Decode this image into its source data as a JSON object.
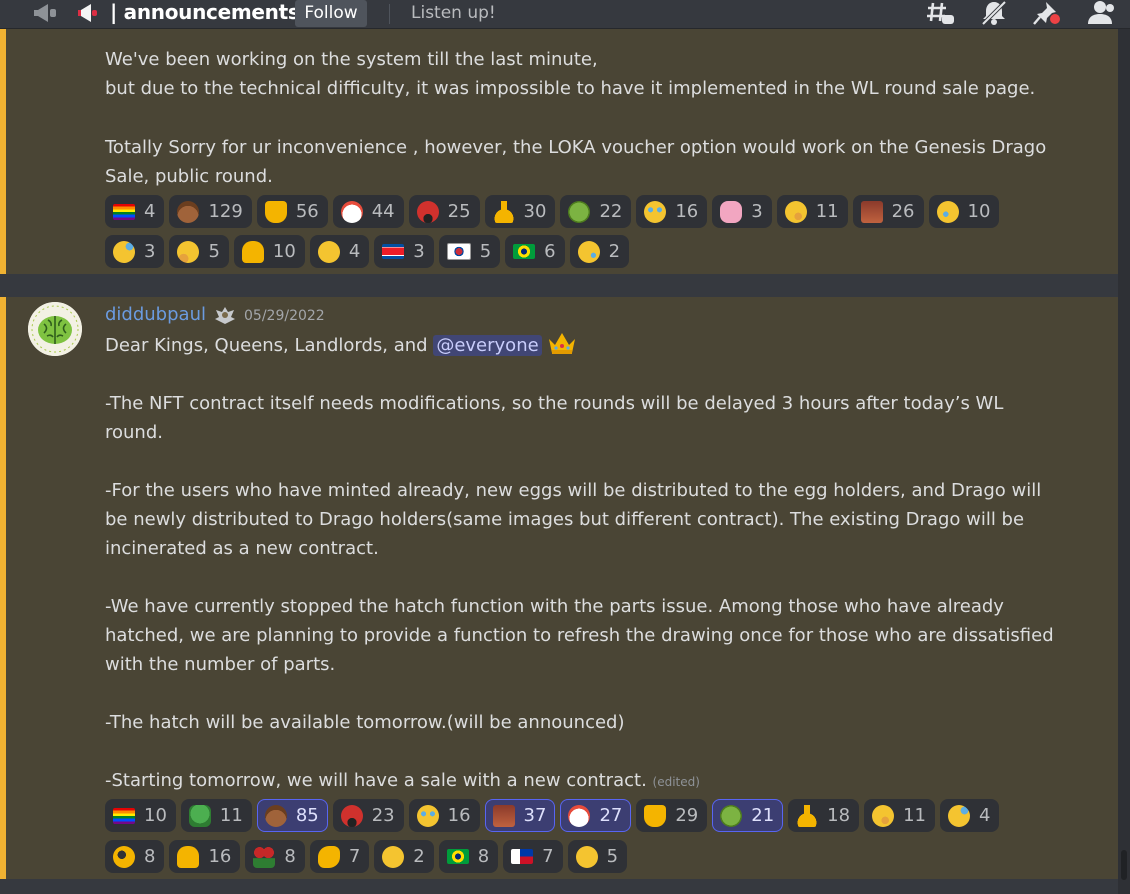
{
  "header": {
    "channel_name": "| announcements",
    "follow_label": "Follow",
    "topic": "Listen up!",
    "icons": [
      "threads-icon",
      "mute-bell-icon",
      "pin-icon",
      "members-icon"
    ]
  },
  "messages": [
    {
      "paragraphs": [
        "We've been working on the system till the last minute,\nbut due to the technical difficulty, it was impossible to have it implemented in the WL round sale page.",
        "Totally Sorry for ur inconvenience , however, the LOKA voucher option would work on the Genesis Drago Sale, public round."
      ],
      "reactions_row1": [
        {
          "emoji": "rainbow-flag",
          "count": "4"
        },
        {
          "emoji": "poop",
          "count": "129"
        },
        {
          "emoji": "thumbs-down",
          "count": "56"
        },
        {
          "emoji": "clown",
          "count": "44"
        },
        {
          "emoji": "angry-swearing",
          "count": "25"
        },
        {
          "emoji": "middle-finger",
          "count": "30"
        },
        {
          "emoji": "nauseated",
          "count": "22"
        },
        {
          "emoji": "joy",
          "count": "16"
        },
        {
          "emoji": "ghost-face",
          "count": "3"
        },
        {
          "emoji": "shushing",
          "count": "11"
        },
        {
          "emoji": "custom-face",
          "count": "26"
        },
        {
          "emoji": "rofl",
          "count": "10"
        }
      ],
      "reactions_row2": [
        {
          "emoji": "sad-sweat",
          "count": "3"
        },
        {
          "emoji": "thinking",
          "count": "5"
        },
        {
          "emoji": "thumbs-up",
          "count": "10"
        },
        {
          "emoji": "upside-down",
          "count": "4"
        },
        {
          "emoji": "flag-north-korea",
          "count": "3"
        },
        {
          "emoji": "flag-south-korea",
          "count": "5"
        },
        {
          "emoji": "flag-brazil",
          "count": "6"
        },
        {
          "emoji": "smiling-tear",
          "count": "2"
        }
      ]
    },
    {
      "author": "diddubpaul",
      "timestamp": "05/29/2022",
      "greeting_prefix": "Dear Kings, Queens, Landlords, and ",
      "mention": "@everyone",
      "paragraphs": [
        "-The NFT contract itself needs modifications, so the rounds will be delayed 3 hours after today’s WL round.",
        "-For the users who have minted already, new eggs will be distributed to the egg holders, and Drago will be newly distributed to Drago holders(same images but different contract). The existing Drago will be incinerated as a new contract.",
        "-We have currently stopped the hatch function with the parts issue. Among those who have already hatched, we are planning to provide a function to refresh the drawing once for those who are dissatisfied with the number of parts.",
        "-The hatch will be available tomorrow.(will be announced)",
        "-Starting tomorrow, we will have a sale with a new contract."
      ],
      "edited_label": "(edited)",
      "reactions_row1": [
        {
          "emoji": "rainbow-flag",
          "count": "10",
          "me": false
        },
        {
          "emoji": "pepe",
          "count": "11",
          "me": false
        },
        {
          "emoji": "poop",
          "count": "85",
          "me": true
        },
        {
          "emoji": "angry-swearing",
          "count": "23",
          "me": false
        },
        {
          "emoji": "joy",
          "count": "16",
          "me": false
        },
        {
          "emoji": "custom-face",
          "count": "37",
          "me": true
        },
        {
          "emoji": "clown",
          "count": "27",
          "me": true
        },
        {
          "emoji": "thumbs-down",
          "count": "29",
          "me": false
        },
        {
          "emoji": "nauseated",
          "count": "21",
          "me": true
        },
        {
          "emoji": "middle-finger",
          "count": "18",
          "me": false
        },
        {
          "emoji": "shushing",
          "count": "11",
          "me": false
        },
        {
          "emoji": "sad-sweat",
          "count": "4",
          "me": false
        }
      ],
      "reactions_row2": [
        {
          "emoji": "ok-hand",
          "count": "8",
          "me": false
        },
        {
          "emoji": "thumbs-up",
          "count": "16",
          "me": false
        },
        {
          "emoji": "rose-bouquet",
          "count": "8",
          "me": false
        },
        {
          "emoji": "clap",
          "count": "7",
          "me": false
        },
        {
          "emoji": "pensive",
          "count": "2",
          "me": false
        },
        {
          "emoji": "flag-brazil",
          "count": "8",
          "me": false
        },
        {
          "emoji": "flag-philippines",
          "count": "7",
          "me": false
        },
        {
          "emoji": "confused",
          "count": "5",
          "me": false
        }
      ]
    }
  ]
}
